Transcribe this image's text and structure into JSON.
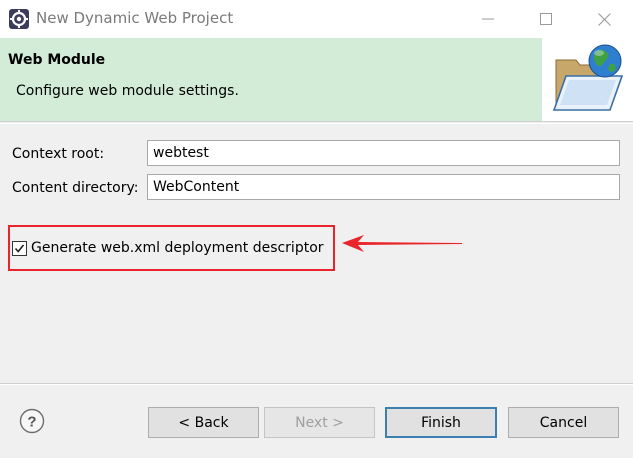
{
  "window": {
    "title": "New Dynamic Web Project",
    "icons": {
      "app": "eclipse-gear-icon",
      "minimize": "minimize-icon",
      "maximize": "maximize-icon",
      "close": "close-icon"
    }
  },
  "header": {
    "title": "Web Module",
    "description": "Configure web module settings.",
    "banner_icon": "folder-globe-icon"
  },
  "form": {
    "context_root": {
      "label": "Context root:",
      "value": "webtest"
    },
    "content_directory": {
      "label": "Content directory:",
      "value": "WebContent"
    },
    "generate_descriptor": {
      "label": "Generate web.xml deployment descriptor",
      "checked": true
    }
  },
  "annotation": {
    "highlight_color": "#e8252a"
  },
  "footer": {
    "help_icon": "help-icon",
    "back_label": "< Back",
    "next_label": "Next >",
    "finish_label": "Finish",
    "cancel_label": "Cancel"
  }
}
